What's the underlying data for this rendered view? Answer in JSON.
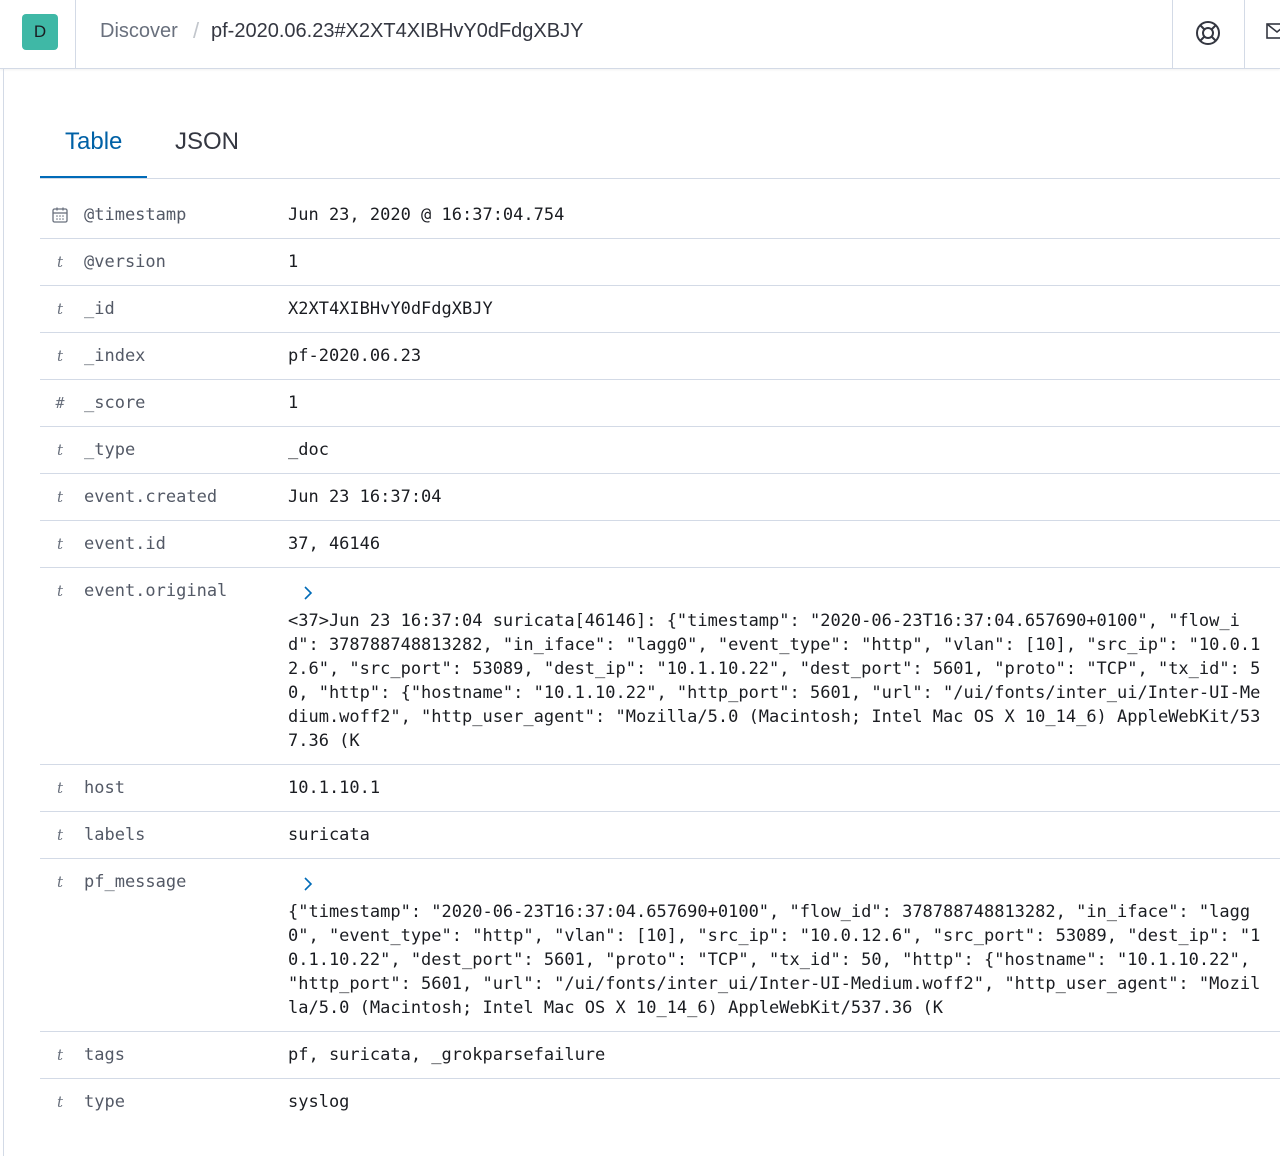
{
  "header": {
    "avatar_letter": "D",
    "breadcrumb_discover": "Discover",
    "breadcrumb_separator": "/",
    "breadcrumb_current": "pf-2020.06.23#X2XT4XIBHvY0dFdgXBJY"
  },
  "tabs": [
    {
      "label": "Table",
      "active": true
    },
    {
      "label": "JSON",
      "active": false
    }
  ],
  "fields": [
    {
      "type_icon": "calendar-icon",
      "name": "@timestamp",
      "value": "Jun 23, 2020 @ 16:37:04.754"
    },
    {
      "type_icon": "t",
      "name": "@version",
      "value": "1"
    },
    {
      "type_icon": "t",
      "name": "_id",
      "value": "X2XT4XIBHvY0dFdgXBJY"
    },
    {
      "type_icon": "t",
      "name": "_index",
      "value": "pf-2020.06.23"
    },
    {
      "type_icon": "#",
      "name": "_score",
      "value": "1"
    },
    {
      "type_icon": "t",
      "name": "_type",
      "value": "_doc"
    },
    {
      "type_icon": "t",
      "name": "event.created",
      "value": "Jun 23 16:37:04"
    },
    {
      "type_icon": "t",
      "name": "event.id",
      "value": "37, 46146"
    },
    {
      "type_icon": "t",
      "name": "event.original",
      "value": "<37>Jun 23 16:37:04 suricata[46146]: {\"timestamp\": \"2020-06-23T16:37:04.657690+0100\", \"flow_id\": 378788748813282, \"in_iface\": \"lagg0\", \"event_type\": \"http\", \"vlan\": [10], \"src_ip\": \"10.0.12.6\", \"src_port\": 53089, \"dest_ip\": \"10.1.10.22\", \"dest_port\": 5601, \"proto\": \"TCP\", \"tx_id\": 50, \"http\": {\"hostname\": \"10.1.10.22\", \"http_port\": 5601, \"url\": \"/ui/fonts/inter_ui/Inter-UI-Medium.woff2\", \"http_user_agent\": \"Mozilla/5.0 (Macintosh; Intel Mac OS X 10_14_6) AppleWebKit/537.36 (K",
      "expandable": true
    },
    {
      "type_icon": "t",
      "name": "host",
      "value": "10.1.10.1"
    },
    {
      "type_icon": "t",
      "name": "labels",
      "value": "suricata"
    },
    {
      "type_icon": "t",
      "name": "pf_message",
      "value": "{\"timestamp\": \"2020-06-23T16:37:04.657690+0100\", \"flow_id\": 378788748813282, \"in_iface\": \"lagg0\", \"event_type\": \"http\", \"vlan\": [10], \"src_ip\": \"10.0.12.6\", \"src_port\": 53089, \"dest_ip\": \"10.1.10.22\", \"dest_port\": 5601, \"proto\": \"TCP\", \"tx_id\": 50, \"http\": {\"hostname\": \"10.1.10.22\", \"http_port\": 5601, \"url\": \"/ui/fonts/inter_ui/Inter-UI-Medium.woff2\", \"http_user_agent\": \"Mozilla/5.0 (Macintosh; Intel Mac OS X 10_14_6) AppleWebKit/537.36 (K",
      "expandable": true
    },
    {
      "type_icon": "t",
      "name": "tags",
      "value": "pf, suricata, _grokparsefailure"
    },
    {
      "type_icon": "t",
      "name": "type",
      "value": "syslog"
    }
  ],
  "colors": {
    "accent": "#006bb8",
    "avatar_bg": "#3fb8a6",
    "border": "#d3dae6"
  }
}
